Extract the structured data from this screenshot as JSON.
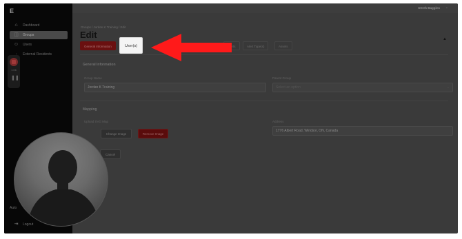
{
  "sidebar": {
    "logo": "E",
    "items": [
      {
        "label": "Dashboard",
        "icon": "home-icon"
      },
      {
        "label": "Groups",
        "icon": "groups-icon"
      },
      {
        "label": "Users",
        "icon": "users-icon"
      },
      {
        "label": "External Residents",
        "icon": "residents-icon"
      }
    ],
    "recording_time": "1:06",
    "bottom_label": "Auto",
    "logout_label": "Logout"
  },
  "topbar": {
    "user_name": "Derek Baggins"
  },
  "breadcrumb": "Groups  /  Jordan K Training  /  Edit",
  "page_title": "Edit",
  "tabs": [
    {
      "label": "General Information",
      "state": "active"
    },
    {
      "label": "User(s)",
      "state": "highlight"
    },
    {
      "label": "Alerts",
      "state": "normal"
    },
    {
      "label": "Alert Type(s)",
      "state": "normal"
    },
    {
      "label": "Assets",
      "state": "normal"
    }
  ],
  "general": {
    "section_title": "General Information",
    "group_name_label": "Group Name",
    "group_name_value": "Jordan K Training",
    "parent_group_label": "Parent Group",
    "parent_group_placeholder": "Select an option"
  },
  "mapping": {
    "section_title": "Mapping",
    "upload_label": "Upload SVG Map",
    "change_image": "Change Image",
    "remove_image": "Remove Image",
    "address_label": "Address",
    "address_value": "1776 Albert Road, Windsor, ON, Canada"
  },
  "actions": {
    "cancel": "Cancel"
  },
  "colors": {
    "accent_red": "#6a1010",
    "arrow_red": "#ff1a1a"
  }
}
